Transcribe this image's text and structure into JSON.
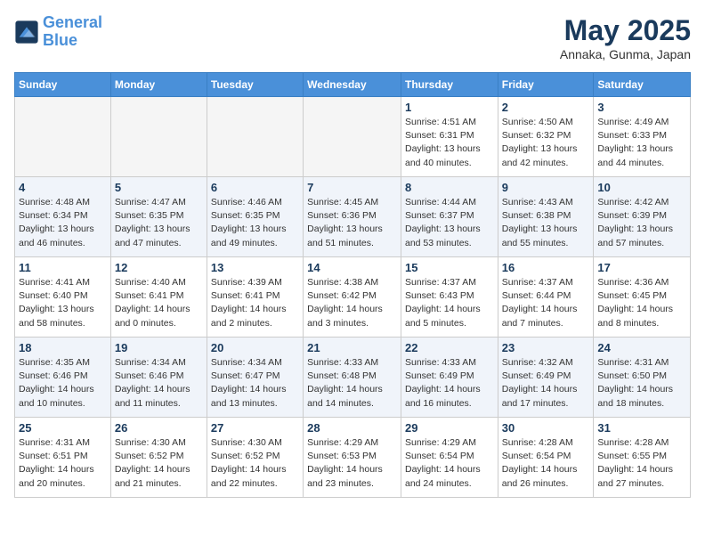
{
  "logo": {
    "line1": "General",
    "line2": "Blue"
  },
  "title": "May 2025",
  "location": "Annaka, Gunma, Japan",
  "headers": [
    "Sunday",
    "Monday",
    "Tuesday",
    "Wednesday",
    "Thursday",
    "Friday",
    "Saturday"
  ],
  "weeks": [
    [
      {
        "day": "",
        "info": ""
      },
      {
        "day": "",
        "info": ""
      },
      {
        "day": "",
        "info": ""
      },
      {
        "day": "",
        "info": ""
      },
      {
        "day": "1",
        "info": "Sunrise: 4:51 AM\nSunset: 6:31 PM\nDaylight: 13 hours\nand 40 minutes."
      },
      {
        "day": "2",
        "info": "Sunrise: 4:50 AM\nSunset: 6:32 PM\nDaylight: 13 hours\nand 42 minutes."
      },
      {
        "day": "3",
        "info": "Sunrise: 4:49 AM\nSunset: 6:33 PM\nDaylight: 13 hours\nand 44 minutes."
      }
    ],
    [
      {
        "day": "4",
        "info": "Sunrise: 4:48 AM\nSunset: 6:34 PM\nDaylight: 13 hours\nand 46 minutes."
      },
      {
        "day": "5",
        "info": "Sunrise: 4:47 AM\nSunset: 6:35 PM\nDaylight: 13 hours\nand 47 minutes."
      },
      {
        "day": "6",
        "info": "Sunrise: 4:46 AM\nSunset: 6:35 PM\nDaylight: 13 hours\nand 49 minutes."
      },
      {
        "day": "7",
        "info": "Sunrise: 4:45 AM\nSunset: 6:36 PM\nDaylight: 13 hours\nand 51 minutes."
      },
      {
        "day": "8",
        "info": "Sunrise: 4:44 AM\nSunset: 6:37 PM\nDaylight: 13 hours\nand 53 minutes."
      },
      {
        "day": "9",
        "info": "Sunrise: 4:43 AM\nSunset: 6:38 PM\nDaylight: 13 hours\nand 55 minutes."
      },
      {
        "day": "10",
        "info": "Sunrise: 4:42 AM\nSunset: 6:39 PM\nDaylight: 13 hours\nand 57 minutes."
      }
    ],
    [
      {
        "day": "11",
        "info": "Sunrise: 4:41 AM\nSunset: 6:40 PM\nDaylight: 13 hours\nand 58 minutes."
      },
      {
        "day": "12",
        "info": "Sunrise: 4:40 AM\nSunset: 6:41 PM\nDaylight: 14 hours\nand 0 minutes."
      },
      {
        "day": "13",
        "info": "Sunrise: 4:39 AM\nSunset: 6:41 PM\nDaylight: 14 hours\nand 2 minutes."
      },
      {
        "day": "14",
        "info": "Sunrise: 4:38 AM\nSunset: 6:42 PM\nDaylight: 14 hours\nand 3 minutes."
      },
      {
        "day": "15",
        "info": "Sunrise: 4:37 AM\nSunset: 6:43 PM\nDaylight: 14 hours\nand 5 minutes."
      },
      {
        "day": "16",
        "info": "Sunrise: 4:37 AM\nSunset: 6:44 PM\nDaylight: 14 hours\nand 7 minutes."
      },
      {
        "day": "17",
        "info": "Sunrise: 4:36 AM\nSunset: 6:45 PM\nDaylight: 14 hours\nand 8 minutes."
      }
    ],
    [
      {
        "day": "18",
        "info": "Sunrise: 4:35 AM\nSunset: 6:46 PM\nDaylight: 14 hours\nand 10 minutes."
      },
      {
        "day": "19",
        "info": "Sunrise: 4:34 AM\nSunset: 6:46 PM\nDaylight: 14 hours\nand 11 minutes."
      },
      {
        "day": "20",
        "info": "Sunrise: 4:34 AM\nSunset: 6:47 PM\nDaylight: 14 hours\nand 13 minutes."
      },
      {
        "day": "21",
        "info": "Sunrise: 4:33 AM\nSunset: 6:48 PM\nDaylight: 14 hours\nand 14 minutes."
      },
      {
        "day": "22",
        "info": "Sunrise: 4:33 AM\nSunset: 6:49 PM\nDaylight: 14 hours\nand 16 minutes."
      },
      {
        "day": "23",
        "info": "Sunrise: 4:32 AM\nSunset: 6:49 PM\nDaylight: 14 hours\nand 17 minutes."
      },
      {
        "day": "24",
        "info": "Sunrise: 4:31 AM\nSunset: 6:50 PM\nDaylight: 14 hours\nand 18 minutes."
      }
    ],
    [
      {
        "day": "25",
        "info": "Sunrise: 4:31 AM\nSunset: 6:51 PM\nDaylight: 14 hours\nand 20 minutes."
      },
      {
        "day": "26",
        "info": "Sunrise: 4:30 AM\nSunset: 6:52 PM\nDaylight: 14 hours\nand 21 minutes."
      },
      {
        "day": "27",
        "info": "Sunrise: 4:30 AM\nSunset: 6:52 PM\nDaylight: 14 hours\nand 22 minutes."
      },
      {
        "day": "28",
        "info": "Sunrise: 4:29 AM\nSunset: 6:53 PM\nDaylight: 14 hours\nand 23 minutes."
      },
      {
        "day": "29",
        "info": "Sunrise: 4:29 AM\nSunset: 6:54 PM\nDaylight: 14 hours\nand 24 minutes."
      },
      {
        "day": "30",
        "info": "Sunrise: 4:28 AM\nSunset: 6:54 PM\nDaylight: 14 hours\nand 26 minutes."
      },
      {
        "day": "31",
        "info": "Sunrise: 4:28 AM\nSunset: 6:55 PM\nDaylight: 14 hours\nand 27 minutes."
      }
    ]
  ]
}
